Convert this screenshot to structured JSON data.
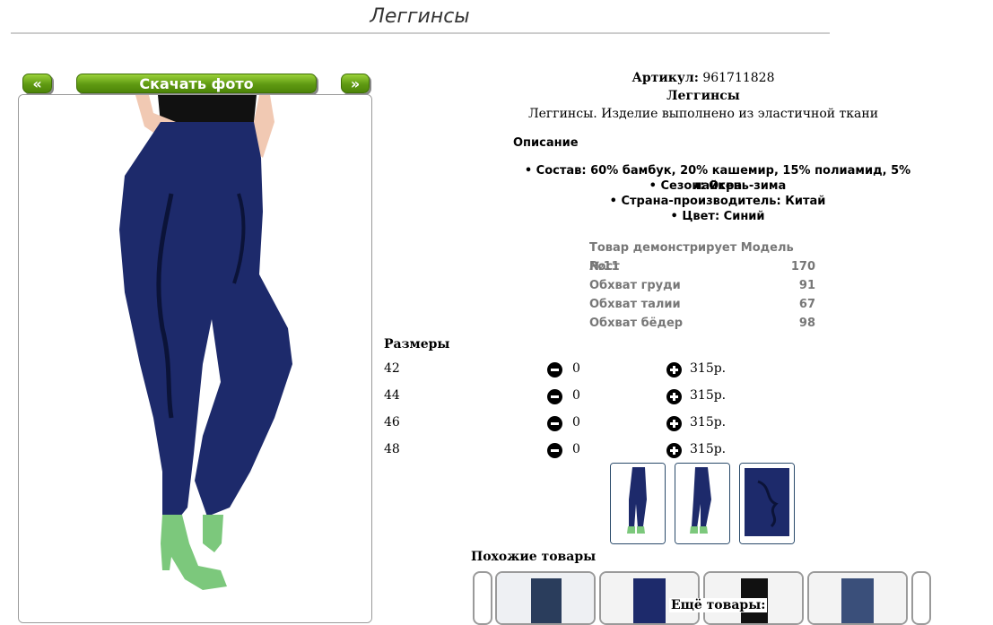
{
  "page": {
    "title": "Леггинсы"
  },
  "gallery": {
    "prev_label": "«",
    "download_label": "Скачать фото",
    "next_label": "»"
  },
  "product": {
    "sku_label": "Артикул:",
    "sku_value": "961711828",
    "name": "Леггинсы",
    "short_desc": "Леггинсы. Изделие выполнено из эластичной ткани"
  },
  "description": {
    "heading": "Описание",
    "items": [
      "Состав: 60% бамбук, 20% кашемир, 15% полиамид, 5% лайкра",
      "Сезон: Осень-зима",
      "Страна-производитель: Китай",
      "Цвет: Синий"
    ]
  },
  "model": {
    "heading": "Товар демонстрирует Модель №11",
    "rows": [
      {
        "label": "Рост",
        "value": "170"
      },
      {
        "label": "Обхват груди",
        "value": "91"
      },
      {
        "label": "Обхват талии",
        "value": "67"
      },
      {
        "label": "Обхват бёдер",
        "value": "98"
      }
    ]
  },
  "sizes": {
    "heading": "Размеры",
    "rows": [
      {
        "size": "42",
        "qty": "0",
        "price": "315р."
      },
      {
        "size": "44",
        "qty": "0",
        "price": "315р."
      },
      {
        "size": "46",
        "qty": "0",
        "price": "315р."
      },
      {
        "size": "48",
        "qty": "0",
        "price": "315р."
      }
    ]
  },
  "related": {
    "similar_heading": "Похожие товары",
    "more_heading": "Ещё товары:"
  },
  "colors": {
    "accent_green": "#5f9a12",
    "product_navy": "#1d2a6b"
  }
}
